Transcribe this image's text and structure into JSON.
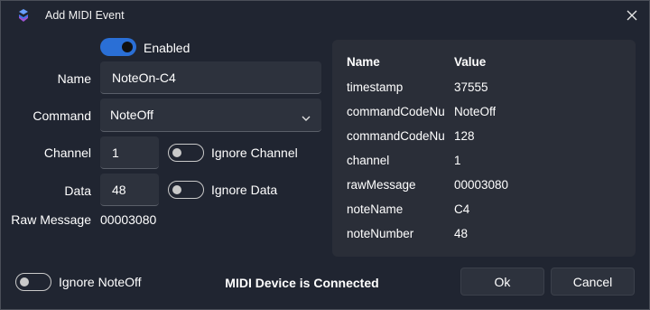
{
  "window": {
    "title": "Add MIDI Event"
  },
  "form": {
    "enabled_label": "Enabled",
    "name_label": "Name",
    "name_value": "NoteOn-C4",
    "command_label": "Command",
    "command_value": "NoteOff",
    "channel_label": "Channel",
    "channel_value": "1",
    "ignore_channel_label": "Ignore Channel",
    "data_label": "Data",
    "data_value": "48",
    "ignore_data_label": "Ignore Data",
    "raw_message_label": "Raw Message",
    "raw_message_value": "00003080",
    "ignore_noteoff_label": "Ignore NoteOff"
  },
  "toggles": {
    "enabled": true,
    "ignore_channel": false,
    "ignore_data": false,
    "ignore_noteoff": false
  },
  "properties": {
    "header_name": "Name",
    "header_value": "Value",
    "rows": [
      {
        "name": "timestamp",
        "value": "37555"
      },
      {
        "name": "commandCodeNu",
        "value": "NoteOff"
      },
      {
        "name": "commandCodeNumber",
        "value": "128"
      },
      {
        "name": "channel",
        "value": "1"
      },
      {
        "name": "rawMessage",
        "value": "00003080"
      },
      {
        "name": "noteName",
        "value": "C4"
      },
      {
        "name": "noteNumber",
        "value": "48"
      }
    ]
  },
  "status_text": "MIDI Device is Connected",
  "buttons": {
    "ok": "Ok",
    "cancel": "Cancel"
  },
  "colors": {
    "accent": "#2a6fd6",
    "background": "#202531",
    "panel": "#2a2e38",
    "field": "#2d323d"
  },
  "icons": {
    "app": "app-logo-icon",
    "close": "close-icon",
    "dropdown": "chevron-down-icon"
  }
}
